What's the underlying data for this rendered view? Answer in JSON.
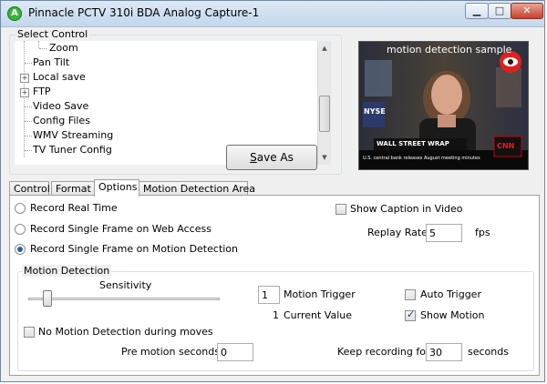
{
  "window": {
    "title": "Pinnacle PCTV 310i BDA Analog Capture-1",
    "icon_letter": "A",
    "minimize_glyph": "▁",
    "maximize_glyph": "□",
    "close_glyph": "✕"
  },
  "select_control": {
    "legend": "Select Control",
    "items": [
      {
        "label": "Zoom",
        "indent": 2,
        "expandable": false
      },
      {
        "label": "Pan Tilt",
        "indent": 1,
        "expandable": false
      },
      {
        "label": "Local save",
        "indent": 1,
        "expandable": true
      },
      {
        "label": "FTP",
        "indent": 1,
        "expandable": true
      },
      {
        "label": "Video Save",
        "indent": 1,
        "expandable": false
      },
      {
        "label": "Config Files",
        "indent": 1,
        "expandable": false
      },
      {
        "label": "WMV Streaming",
        "indent": 1,
        "expandable": false
      },
      {
        "label": "TV Tuner Config",
        "indent": 1,
        "expandable": false
      }
    ],
    "save_as_label": "Save As",
    "save_as_underline": "S"
  },
  "preview": {
    "overlay_caption": "motion detection sample",
    "banner_text": "WALL STREET WRAP",
    "ticker_text": "U.S. central bank releases August meeting minutes",
    "logo_text": "CNN",
    "screen_letters": "NYSE"
  },
  "tabs": [
    {
      "label": "Control",
      "active": false
    },
    {
      "label": "Format",
      "active": false
    },
    {
      "label": "Options",
      "active": true
    },
    {
      "label": "Motion Detection Area",
      "active": false
    }
  ],
  "options": {
    "record_real_time": "Record Real Time",
    "record_single_frame_web": "Record Single Frame on Web Access",
    "record_single_frame_motion": "Record Single Frame on Motion Detection",
    "selected_mode": "record_single_frame_motion",
    "show_caption_label": "Show Caption in Video",
    "show_caption_checked": false,
    "replay_rate_label": "Replay Rate",
    "replay_rate_value": "5",
    "replay_rate_unit": "fps"
  },
  "motion_detection": {
    "legend": "Motion Detection",
    "sensitivity_label": "Sensitivity",
    "sensitivity_level": 0.08,
    "motion_trigger_value": "1",
    "motion_trigger_label": "Motion Trigger",
    "current_value_number": "1",
    "current_value_label": "Current Value",
    "auto_trigger_label": "Auto Trigger",
    "auto_trigger_checked": false,
    "show_motion_label": "Show Motion",
    "show_motion_checked": true,
    "no_motion_during_moves_label": "No Motion Detection during moves",
    "no_motion_during_moves_checked": false,
    "pre_motion_label": "Pre motion seconds",
    "pre_motion_value": "0",
    "keep_recording_label": "Keep recording for",
    "keep_recording_value": "30",
    "keep_recording_unit": "seconds"
  }
}
